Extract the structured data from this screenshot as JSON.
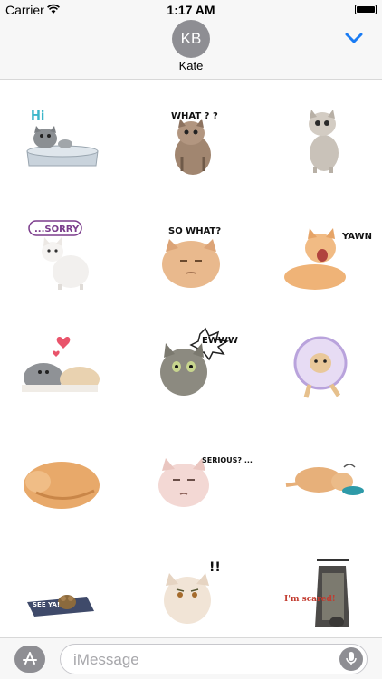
{
  "status_bar": {
    "carrier": "Carrier",
    "time": "1:17 AM"
  },
  "conversation": {
    "initials": "KB",
    "name": "Kate"
  },
  "stickers": [
    {
      "caption": "Hi",
      "icon": "cat-in-tub-icon"
    },
    {
      "caption": "WHAT ? ?",
      "icon": "cat-what-icon"
    },
    {
      "caption": "",
      "icon": "cat-standing-icon"
    },
    {
      "caption": "...SORRY",
      "icon": "cat-sorry-icon"
    },
    {
      "caption": "SO WHAT?",
      "icon": "cat-so-what-icon"
    },
    {
      "caption": "YAWN",
      "icon": "cat-yawn-icon"
    },
    {
      "caption": "",
      "icon": "cats-love-icon"
    },
    {
      "caption": "EWWW",
      "icon": "cat-ewww-icon"
    },
    {
      "caption": "",
      "icon": "cat-cone-icon"
    },
    {
      "caption": "",
      "icon": "cat-sleeping-icon"
    },
    {
      "caption": "SERIOUS? ...",
      "icon": "cat-serious-icon"
    },
    {
      "caption": "",
      "icon": "cat-eating-icon"
    },
    {
      "caption": "SEE YA!",
      "icon": "cat-see-ya-icon"
    },
    {
      "caption": "!!",
      "icon": "cat-shocked-icon"
    },
    {
      "caption": "I'm scared!",
      "icon": "cat-scared-icon"
    }
  ],
  "compose": {
    "placeholder": "iMessage"
  }
}
